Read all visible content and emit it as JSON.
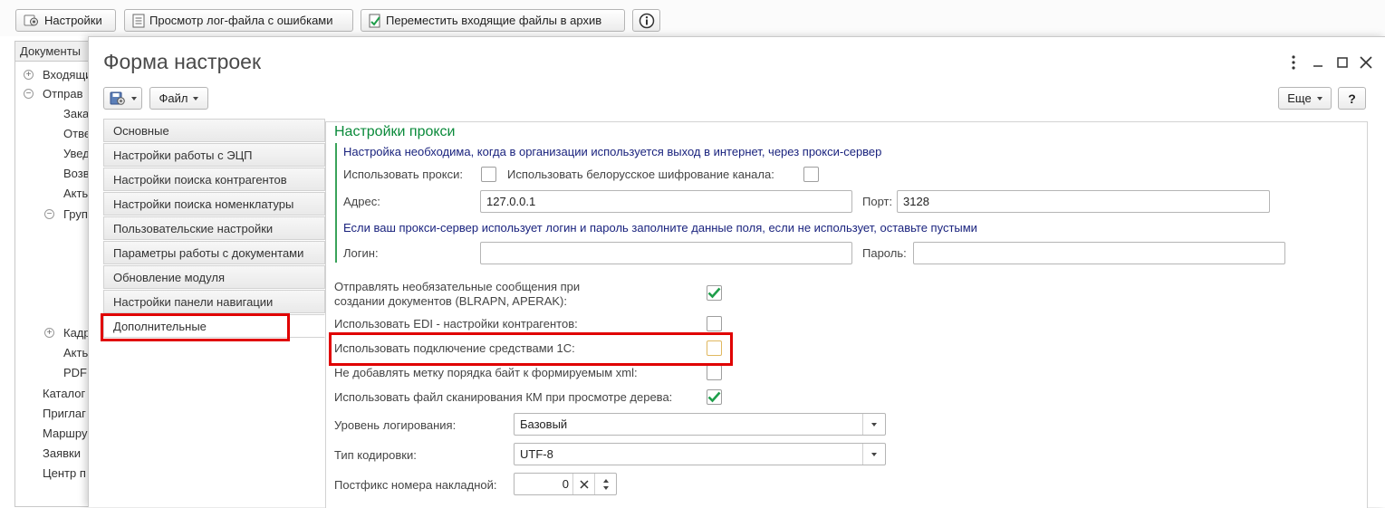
{
  "toolbar": {
    "settings_label": "Настройки",
    "view_log_label": "Просмотр лог-файла с ошибками",
    "archive_label": "Переместить входящие файлы в архив"
  },
  "background_nav": {
    "header": "Документы",
    "items": [
      "Входящи",
      "Отправ",
      "Зака",
      "Отве",
      "Увед",
      "Возв",
      "Акты",
      "Груп",
      "Кадр",
      "Акть",
      "PDF",
      "Каталог",
      "Приглаг",
      "Маршру",
      "Заявки",
      "Центр п"
    ]
  },
  "modal": {
    "title": "Форма настроек",
    "file_label": "Файл",
    "more_label": "Еще",
    "help_label": "?"
  },
  "tabs": [
    "Основные",
    "Настройки работы с ЭЦП",
    "Настройки поиска контрагентов",
    "Настройки поиска номенклатуры",
    "Пользовательские настройки",
    "Параметры работы с документами",
    "Обновление модуля",
    "Настройки панели навигации",
    "Дополнительные"
  ],
  "proxy": {
    "title": "Настройки прокси",
    "note": "Настройка необходима, когда в организации используется выход в интернет, через прокси-сервер",
    "use_proxy_label": "Использовать прокси:",
    "use_proxy_checked": false,
    "belarus_label": "Использовать белорусское шифрование канала:",
    "belarus_checked": false,
    "address_label": "Адрес:",
    "address_value": "127.0.0.1",
    "port_label": "Порт:",
    "port_value": "3128",
    "login_note": "Если ваш прокси-сервер использует логин и пароль заполните данные поля, если не использует, оставьте пустыми",
    "login_label": "Логин:",
    "login_value": "",
    "password_label": "Пароль:",
    "password_value": ""
  },
  "options": {
    "optional_msgs_line1": "Отправлять необязательные сообщения при",
    "optional_msgs_line2": "создании документов (BLRAPN, APERAK):",
    "optional_msgs_checked": true,
    "edi_label": "Использовать EDI - настройки контрагентов:",
    "edi_checked": false,
    "conn_1c_label": "Использовать подключение средствами 1С:",
    "conn_1c_checked": false,
    "bom_label": "Не добавлять метку порядка байт к формируемым xml:",
    "bom_checked": false,
    "scan_file_label": "Использовать файл сканирования КМ при просмотре дерева:",
    "scan_file_checked": true
  },
  "logging": {
    "level_label": "Уровень логирования:",
    "level_value": "Базовый",
    "encoding_label": "Тип кодировки:",
    "encoding_value": "UTF-8",
    "postfix_label": "Постфикс номера накладной:",
    "postfix_value": "0"
  },
  "colors": {
    "accent_green": "#0a8a3a",
    "check_green": "#1e9e4a",
    "highlight_red": "#e00000",
    "note_blue": "#1a237e"
  }
}
